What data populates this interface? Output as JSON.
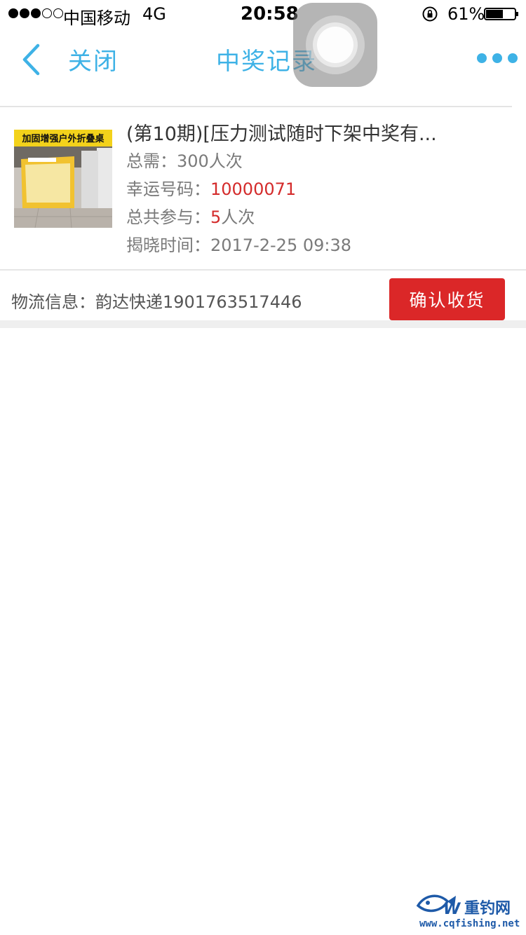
{
  "status_bar": {
    "carrier": "中国移动",
    "network": "4G",
    "time": "20:58",
    "battery_percent": "61%",
    "signal_strength": 3,
    "signal_max": 5,
    "battery_level": 0.61
  },
  "nav": {
    "close_label": "关闭",
    "title": "中奖记录",
    "accent_color": "#3eb2e6"
  },
  "record": {
    "product_title": "(第10期)[压力测试随时下架中奖有...",
    "thumb_caption": "加固增强户外折叠桌",
    "total_needed_label": "总需：",
    "total_needed_value": "300人次",
    "lucky_number_label": "幸运号码：",
    "lucky_number_value": "10000071",
    "participation_label": "总共参与：",
    "participation_count": "5",
    "participation_unit": "人次",
    "reveal_time_label": "揭晓时间：",
    "reveal_time_value": "2017-2-25 09:38"
  },
  "logistics": {
    "label": "物流信息：",
    "value": "韵达快递1901763517446",
    "confirm_button": "确认收货",
    "button_color": "#db2728"
  },
  "watermark": {
    "name": "重钓网",
    "url": "www.cqfishing.net"
  }
}
